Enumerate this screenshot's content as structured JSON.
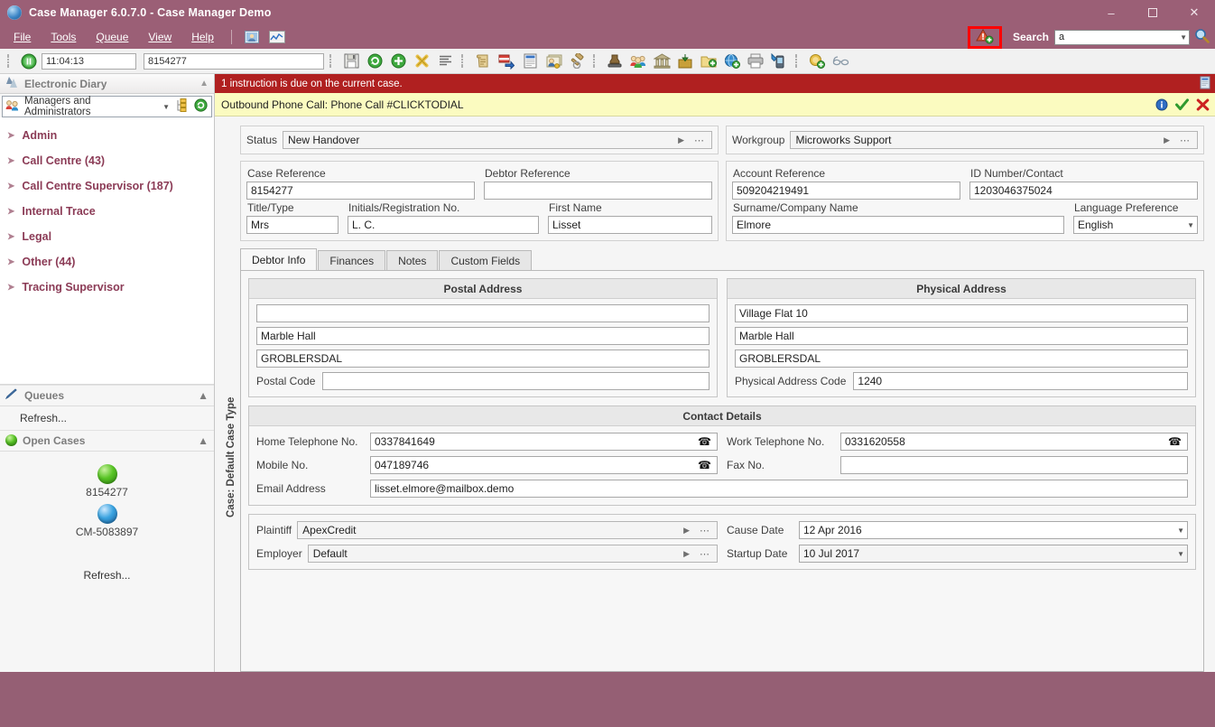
{
  "window": {
    "title": "Case Manager 6.0.7.0 - Case Manager Demo",
    "minimize": "–",
    "maximize": "",
    "close": "✕",
    "accent": "#9b5f76"
  },
  "menu": {
    "items": [
      "File",
      "Tools",
      "Queue",
      "View",
      "Help"
    ],
    "icons": [
      "user-card-icon",
      "chart-line-icon"
    ],
    "highlight_icon": "alert-add-icon",
    "search_label": "Search",
    "search_value": "a",
    "search_placeholder": "",
    "search_icon": "magnifier-icon"
  },
  "toolbar": {
    "time_value": "11:04:13",
    "case_value": "8154277",
    "icons": [
      "save-icon",
      "refresh-icon",
      "add-icon",
      "cancel-icon",
      "list-icon",
      "scroll-icon",
      "transfer-icon",
      "document-icon",
      "contacts-icon",
      "gavel-icon",
      "stamp-icon",
      "group-icon",
      "bank-icon",
      "box-down-icon",
      "folder-add-icon",
      "globe-add-icon",
      "print-icon",
      "phone-edit-icon",
      "coin-add-icon",
      "glasses-icon"
    ]
  },
  "sidebar": {
    "diary_header": "Electronic Diary",
    "diary_icon": "diary-icon",
    "group_selector": "Managers and Administrators",
    "group_icon": "people-icon",
    "group_tree_icon": "tree-icon",
    "group_refresh_icon": "refresh-icon",
    "tree_items": [
      {
        "label": "Admin"
      },
      {
        "label": "Call Centre (43)"
      },
      {
        "label": "Call Centre Supervisor (187)"
      },
      {
        "label": "Internal Trace"
      },
      {
        "label": "Legal"
      },
      {
        "label": "Other (44)"
      },
      {
        "label": "Tracing Supervisor"
      }
    ],
    "queues_header": "Queues",
    "queues_icon": "pen-icon",
    "queues_refresh": "Refresh...",
    "open_cases_header": "Open Cases",
    "open_cases_icon": "green-ball-icon",
    "open_cases": [
      {
        "label": "8154277",
        "color": "green"
      },
      {
        "label": "CM-5083897",
        "color": "blue"
      }
    ],
    "open_cases_refresh": "Refresh...",
    "collapse_icon": "chevron-up-icon"
  },
  "alerts": {
    "red": {
      "text": "1 instruction is due on the current case.",
      "icon": "document-icon",
      "color": "#b02020"
    },
    "yellow": {
      "text": "Outbound Phone Call: Phone Call #CLICKTODIAL",
      "icons": [
        "info-icon",
        "accept-check-icon",
        "reject-cross-icon"
      ],
      "color": "#fbfbc0"
    }
  },
  "case_panel": {
    "vertical_label": "Case: Default Case Type",
    "status": {
      "label": "Status",
      "value": "New Handover"
    },
    "workgroup": {
      "label": "Workgroup",
      "value": "Microworks Support"
    },
    "fields": {
      "case_reference": {
        "label": "Case Reference",
        "value": "8154277"
      },
      "debtor_reference": {
        "label": "Debtor Reference",
        "value": ""
      },
      "account_reference": {
        "label": "Account Reference",
        "value": "509204219491"
      },
      "id_number_contact": {
        "label": "ID Number/Contact",
        "value": "1203046375024"
      },
      "title_type": {
        "label": "Title/Type",
        "value": "Mrs"
      },
      "initials_registration": {
        "label": "Initials/Registration No.",
        "value": "L. C."
      },
      "first_name": {
        "label": "First Name",
        "value": "Lisset"
      },
      "surname_company": {
        "label": "Surname/Company Name",
        "value": "Elmore"
      },
      "language_preference": {
        "label": "Language Preference",
        "value": "English"
      }
    },
    "tabs": [
      {
        "label": "Debtor Info",
        "active": true
      },
      {
        "label": "Finances",
        "active": false
      },
      {
        "label": "Notes",
        "active": false
      },
      {
        "label": "Custom Fields",
        "active": false
      }
    ],
    "postal_address": {
      "title": "Postal Address",
      "line1": "",
      "line2": "Marble Hall",
      "line3": "GROBLERSDAL",
      "code_label": "Postal Code",
      "code_value": ""
    },
    "physical_address": {
      "title": "Physical Address",
      "line1": "Village Flat 10",
      "line2": "Marble Hall",
      "line3": "GROBLERSDAL",
      "code_label": "Physical Address Code",
      "code_value": "1240"
    },
    "contact_details": {
      "title": "Contact Details",
      "home_phone": {
        "label": "Home Telephone No.",
        "value": "0337841649"
      },
      "work_phone": {
        "label": "Work Telephone No.",
        "value": "0331620558"
      },
      "mobile": {
        "label": "Mobile No.",
        "value": "047189746"
      },
      "fax": {
        "label": "Fax No.",
        "value": ""
      },
      "email": {
        "label": "Email Address",
        "value": "lisset.elmore@mailbox.demo"
      }
    },
    "bottom": {
      "plaintiff": {
        "label": "Plaintiff",
        "value": "ApexCredit"
      },
      "cause_date": {
        "label": "Cause Date",
        "value": "12 Apr 2016"
      },
      "employer": {
        "label": "Employer",
        "value": "Default"
      },
      "startup_date": {
        "label": "Startup Date",
        "value": "10 Jul 2017"
      }
    }
  }
}
